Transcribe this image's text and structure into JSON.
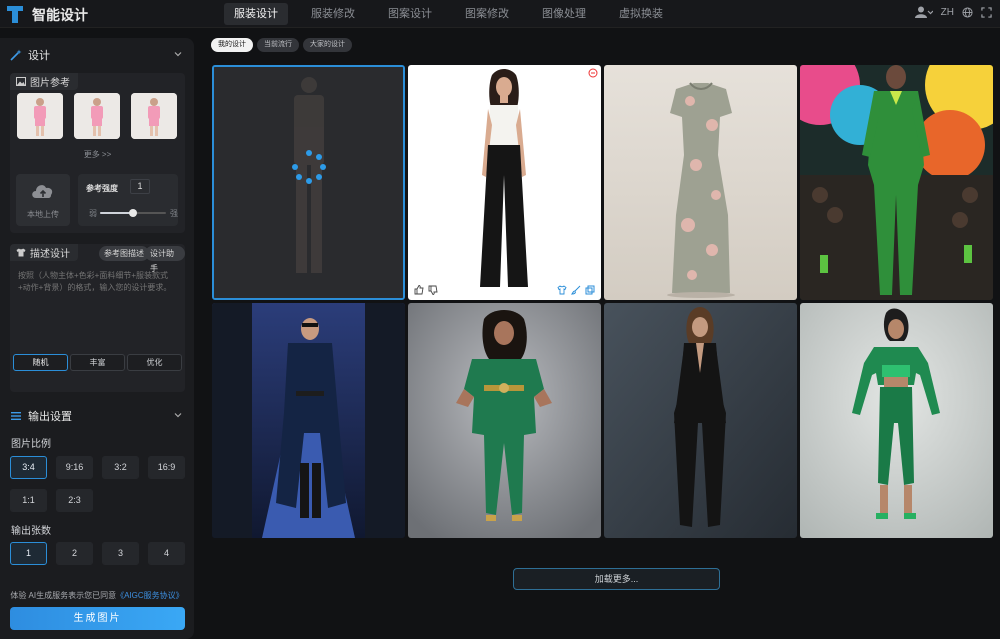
{
  "app": {
    "title": "智能设计"
  },
  "nav": {
    "items": [
      {
        "label": "服装设计",
        "active": true
      },
      {
        "label": "服装修改",
        "active": false
      },
      {
        "label": "图案设计",
        "active": false
      },
      {
        "label": "图案修改",
        "active": false
      },
      {
        "label": "图像处理",
        "active": false
      },
      {
        "label": "虚拟换装",
        "active": false
      }
    ],
    "language": "ZH"
  },
  "sidebar": {
    "design_title": "设计",
    "ref": {
      "title": "图片参考",
      "more": "更多 >>",
      "upload_label": "本地上传",
      "strength_label": "参考强度",
      "strength_value": "1",
      "strength_fraction": 0.5,
      "weak": "弱",
      "strong": "强"
    },
    "desc": {
      "title": "描述设计",
      "btn_ref_desc": "参考图描述",
      "btn_assistant": "设计助手",
      "placeholder": "按照（人物主体+色彩+面料细节+服装款式+动作+背景）的格式，输入您的设计要求。",
      "modes": [
        "随机",
        "丰富",
        "优化"
      ],
      "active_mode": 0
    },
    "output": {
      "title": "输出设置",
      "ratio_label": "图片比例",
      "ratios": [
        "3:4",
        "9:16",
        "3:2",
        "16:9",
        "1:1",
        "2:3"
      ],
      "active_ratio": 0,
      "count_label": "输出张数",
      "counts": [
        "1",
        "2",
        "3",
        "4"
      ],
      "active_count": 0
    },
    "agreement_text": "体验 AI生成服务表示您已同意",
    "agreement_link": "《AIGC服务协议》",
    "generate": "生成图片"
  },
  "main": {
    "tabs": [
      {
        "label": "我的设计",
        "active": true
      },
      {
        "label": "当前流行",
        "active": false
      },
      {
        "label": "大家的设计",
        "active": false
      }
    ],
    "load_more": "加载更多..."
  },
  "colors": {
    "accent": "#2b8ed8",
    "generate_start": "#2e8de0",
    "generate_end": "#3aa8f5",
    "bg": "#111214"
  }
}
